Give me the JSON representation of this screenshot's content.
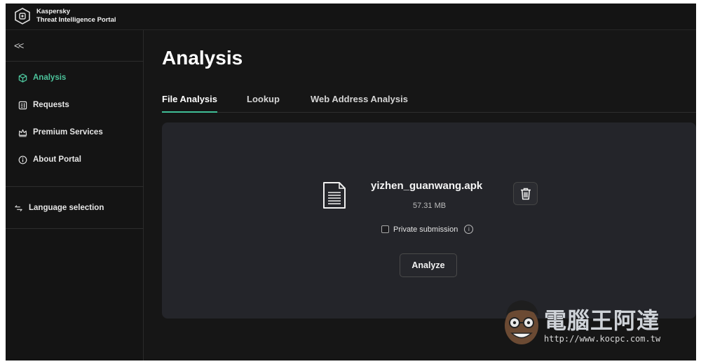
{
  "brand": {
    "line1": "Kaspersky",
    "line2": "Threat Intelligence Portal"
  },
  "sidebar": {
    "collapse_label": "<<",
    "items": [
      {
        "label": "Analysis",
        "icon": "cube-icon",
        "active": true
      },
      {
        "label": "Requests",
        "icon": "document-list-icon"
      },
      {
        "label": "Premium Services",
        "icon": "crown-icon"
      },
      {
        "label": "About Portal",
        "icon": "info-icon"
      }
    ],
    "language": {
      "label": "Language selection",
      "icon": "swap-arrows-icon"
    }
  },
  "main": {
    "title": "Analysis",
    "tabs": [
      {
        "label": "File Analysis",
        "active": true
      },
      {
        "label": "Lookup"
      },
      {
        "label": "Web Address Analysis"
      }
    ],
    "file": {
      "name": "yizhen_guanwang.apk",
      "size": "57.31 MB"
    },
    "private_submission": {
      "label": "Private submission",
      "checked": false
    },
    "analyze_label": "Analyze"
  },
  "watermark": {
    "title": "電腦王阿達",
    "url": "http://www.kocpc.com.tw"
  },
  "colors": {
    "accent": "#3fbf97",
    "background": "#161616",
    "card": "#24252a"
  }
}
